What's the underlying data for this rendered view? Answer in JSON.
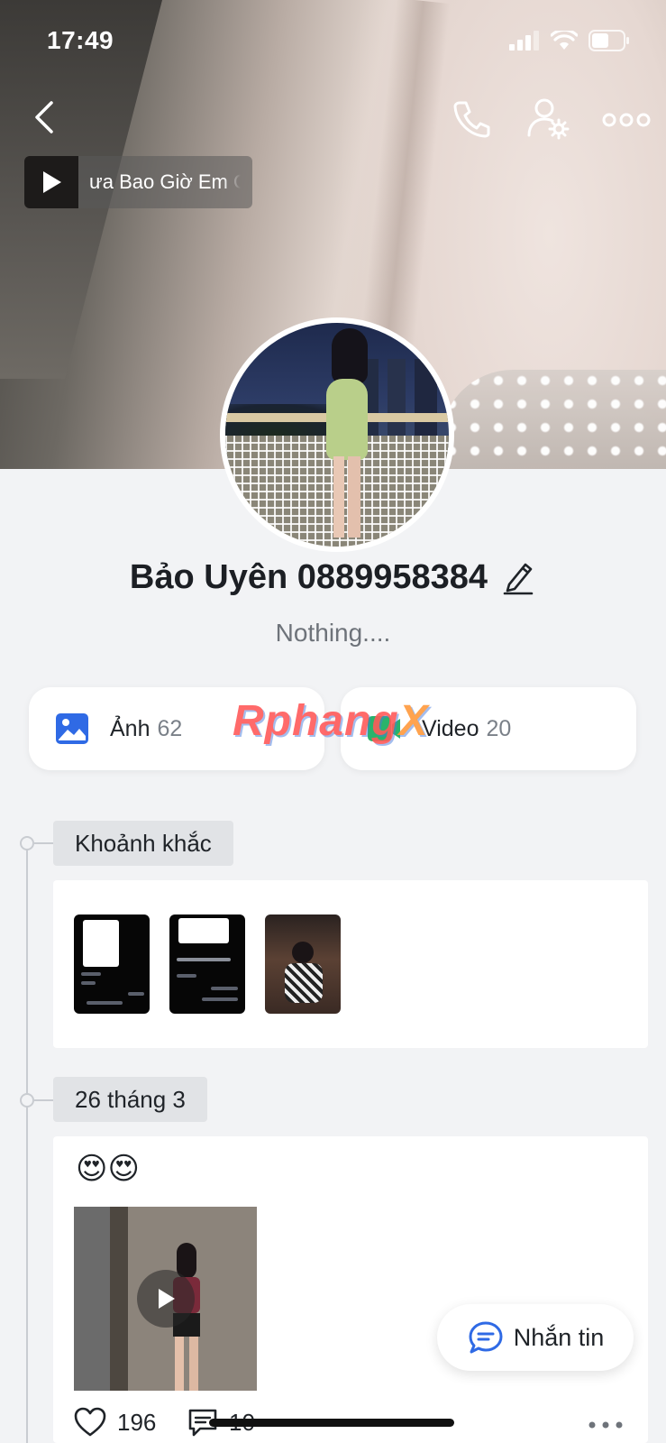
{
  "status_bar": {
    "time": "17:49"
  },
  "music": {
    "title": "ưa Bao Giờ Em C"
  },
  "profile": {
    "name": "Bảo Uyên 0889958384",
    "status": "Nothing...."
  },
  "media": {
    "photos": {
      "label": "Ảnh",
      "count": "62"
    },
    "videos": {
      "label": "Video",
      "count": "20"
    }
  },
  "watermark": {
    "main": "Rphang",
    "suffix": "X"
  },
  "timeline": {
    "moments_label": "Khoảnh khắc",
    "moments_count_visible": 3,
    "date_label": "26 tháng 3"
  },
  "post": {
    "emoji": "😍😍",
    "likes": "196",
    "comments": "10"
  },
  "message_button": {
    "label": "Nhắn tin"
  },
  "colors": {
    "accent_blue": "#2f6ae5",
    "video_green": "#29b36b",
    "background": "#f2f3f5"
  },
  "icons": [
    "back-arrow-icon",
    "phone-icon",
    "user-settings-icon",
    "more-dots-icon",
    "play-icon",
    "edit-pencil-icon",
    "image-icon",
    "video-icon",
    "heart-icon",
    "comment-icon",
    "chat-bubble-icon"
  ]
}
